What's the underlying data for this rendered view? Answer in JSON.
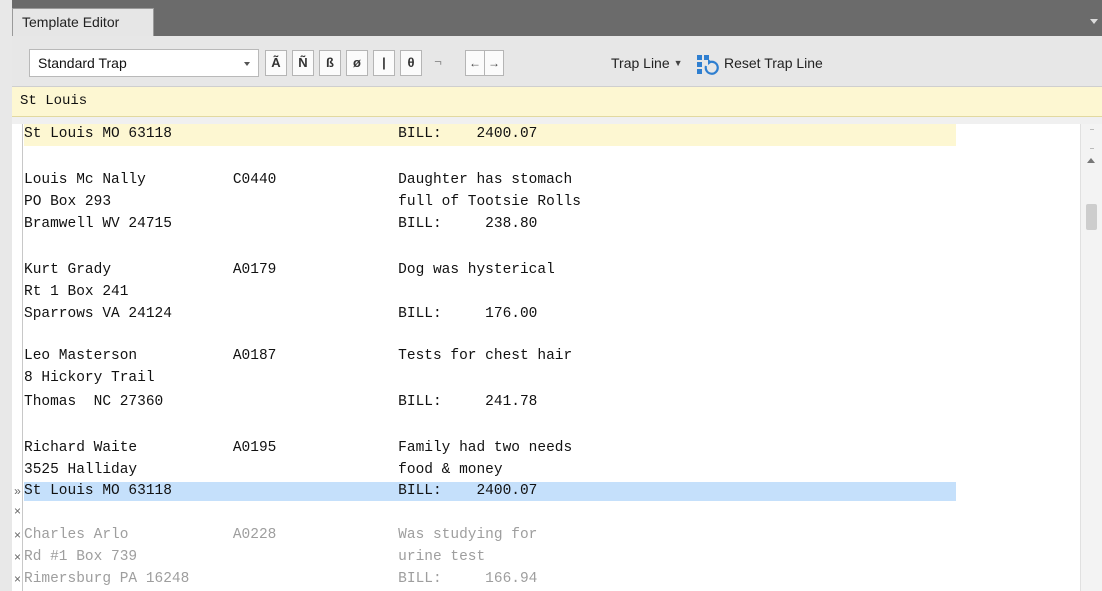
{
  "tab": {
    "title": "Template Editor"
  },
  "toolbar": {
    "mode": "Standard Trap",
    "chars": [
      "Ã",
      "Ñ",
      "ß",
      "ø",
      "|",
      "θ",
      "¬"
    ],
    "arrow_left": "←",
    "arrow_right": "→",
    "trap_line": "Trap Line",
    "reset": "Reset Trap Line"
  },
  "search": {
    "value": "St Louis"
  },
  "pinned_line": "St Louis MO 63118                          BILL:    2400.07",
  "lines": {
    "l1": "Louis Mc Nally          C0440              Daughter has stomach",
    "l2": "PO Box 293                                 full of Tootsie Rolls",
    "l3": "Bramwell WV 24715                          BILL:     238.80",
    "l4": "Kurt Grady              A0179              Dog was hysterical",
    "l5": "Rt 1 Box 241",
    "l6": "Sparrows VA 24124                          BILL:     176.00",
    "l7": "Leo Masterson           A0187              Tests for chest hair",
    "l8": "8 Hickory Trail",
    "l9": "Thomas  NC 27360                           BILL:     241.78",
    "l10": "Richard Waite           A0195              Family had two needs",
    "l11": "3525 Halliday                              food & money",
    "l12": "St Louis MO 63118                          BILL:    2400.07",
    "l13": "Charles Arlo            A0228              Was studying for",
    "l14": "Rd #1 Box 739                              urine test",
    "l15": "Rimersburg PA 16248                        BILL:     166.94"
  },
  "markers": {
    "current": "»",
    "excluded": "×"
  }
}
